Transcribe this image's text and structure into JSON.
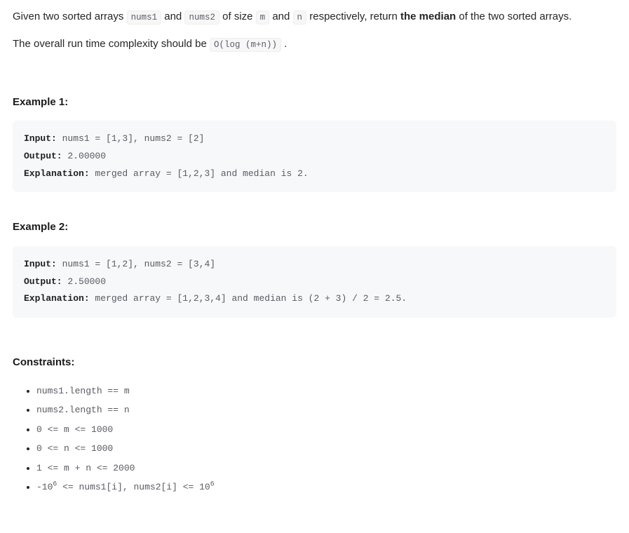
{
  "problem": {
    "para1_pre": "Given two sorted arrays ",
    "code1": "nums1",
    "para1_mid1": " and ",
    "code2": "nums2",
    "para1_mid2": " of size ",
    "code3": "m",
    "para1_mid3": " and ",
    "code4": "n",
    "para1_mid4": " respectively, return ",
    "bold1": "the median",
    "para1_post": " of the two sorted arrays.",
    "para2_pre": "The overall run time complexity should be ",
    "code5": "O(log (m+n))",
    "para2_post": " ."
  },
  "examples": {
    "title1": "Example 1:",
    "ex1": {
      "input_label": "Input:",
      "input_value": " nums1 = [1,3], nums2 = [2]",
      "output_label": "Output:",
      "output_value": " 2.00000",
      "explanation_label": "Explanation:",
      "explanation_value": " merged array = [1,2,3] and median is 2."
    },
    "title2": "Example 2:",
    "ex2": {
      "input_label": "Input:",
      "input_value": " nums1 = [1,2], nums2 = [3,4]",
      "output_label": "Output:",
      "output_value": " 2.50000",
      "explanation_label": "Explanation:",
      "explanation_value": " merged array = [1,2,3,4] and median is (2 + 3) / 2 = 2.5."
    }
  },
  "constraints": {
    "title": "Constraints:",
    "items": {
      "c0": "nums1.length == m",
      "c1": "nums2.length == n",
      "c2": "0 <= m <= 1000",
      "c3": "0 <= n <= 1000",
      "c4": "1 <= m + n <= 2000",
      "c5_pre": "-10",
      "c5_sup1": "6",
      "c5_mid": " <= nums1[i], nums2[i] <= 10",
      "c5_sup2": "6"
    }
  }
}
